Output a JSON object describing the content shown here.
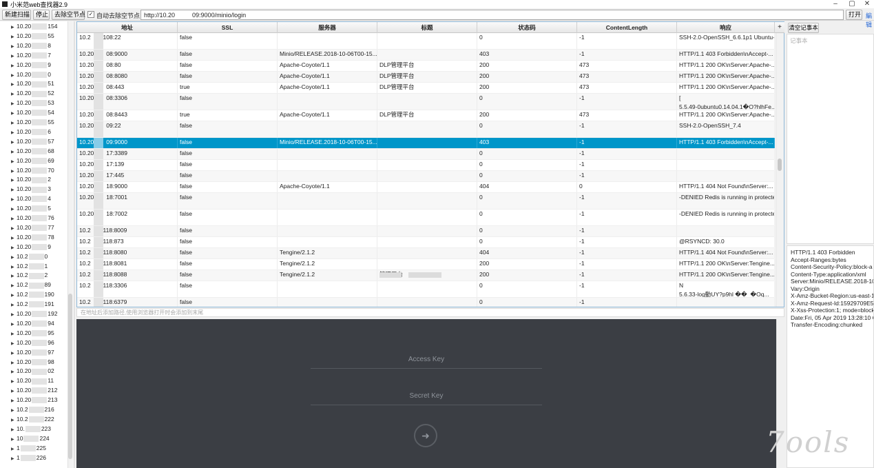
{
  "window": {
    "title": "小米范web查找器2.9",
    "min": "–",
    "max": "▢",
    "close": "✕"
  },
  "toolbar": {
    "new_scan": "新建扫描",
    "stop": "停止",
    "remove_empty": "去除空节点",
    "auto_remove_checked": "✓",
    "auto_remove_label": "自动去除空节点",
    "url_value": "http://10.20          09:9000/minio/login",
    "open": "打开",
    "edge_link": "編辑"
  },
  "tree": {
    "items": [
      {
        "pre": "10.20",
        "post": "154"
      },
      {
        "pre": "10.20",
        "post": "55"
      },
      {
        "pre": "10.20",
        "post": "8"
      },
      {
        "pre": "10.20",
        "post": "7"
      },
      {
        "pre": "10.20",
        "post": "9"
      },
      {
        "pre": "10.20",
        "post": "0"
      },
      {
        "pre": "10.20",
        "post": "51"
      },
      {
        "pre": "10.20",
        "post": "52"
      },
      {
        "pre": "10.20",
        "post": "53"
      },
      {
        "pre": "10.20",
        "post": "54"
      },
      {
        "pre": "10.20",
        "post": "55"
      },
      {
        "pre": "10.20",
        "post": "6"
      },
      {
        "pre": "10.20",
        "post": "57"
      },
      {
        "pre": "10.20",
        "post": "68"
      },
      {
        "pre": "10.20",
        "post": "69"
      },
      {
        "pre": "10.20",
        "post": "70"
      },
      {
        "pre": "10.20",
        "post": "2"
      },
      {
        "pre": "10.20",
        "post": "3"
      },
      {
        "pre": "10.20",
        "post": "4"
      },
      {
        "pre": "10.20",
        "post": "5"
      },
      {
        "pre": "10.20",
        "post": "76"
      },
      {
        "pre": "10.20",
        "post": "77"
      },
      {
        "pre": "10.20",
        "post": "78"
      },
      {
        "pre": "10.20",
        "post": "9"
      },
      {
        "pre": "10.2",
        "post": "0"
      },
      {
        "pre": "10.2",
        "post": "1"
      },
      {
        "pre": "10.2",
        "post": "2"
      },
      {
        "pre": "10.2",
        "post": "89"
      },
      {
        "pre": "10.2",
        "post": "190"
      },
      {
        "pre": "10.2",
        "post": "191"
      },
      {
        "pre": "10.20",
        "post": "192"
      },
      {
        "pre": "10.20",
        "post": "94"
      },
      {
        "pre": "10.20",
        "post": "95"
      },
      {
        "pre": "10.20",
        "post": "96"
      },
      {
        "pre": "10.20",
        "post": "97"
      },
      {
        "pre": "10.20",
        "post": "98"
      },
      {
        "pre": "10.20",
        "post": "02"
      },
      {
        "pre": "10.20",
        "post": "11"
      },
      {
        "pre": "10.20",
        "post": "212"
      },
      {
        "pre": "10.20",
        "post": "213"
      },
      {
        "pre": "10.2",
        "post": "216"
      },
      {
        "pre": "10.2",
        "post": "222"
      },
      {
        "pre": "10.",
        "post": "223"
      },
      {
        "pre": "10",
        "post": "224"
      },
      {
        "pre": "1",
        "post": "225"
      },
      {
        "pre": "1",
        "post": "226"
      }
    ]
  },
  "table": {
    "headers": [
      "地址",
      "SSL",
      "服务器",
      "标题",
      "状态码",
      "ContentLength",
      "响应"
    ],
    "more": "+",
    "rows": [
      {
        "addr_pre": "10.2",
        "addr": "108:22",
        "ssl": "false",
        "server": "",
        "title": "",
        "code": "0",
        "len": "-1",
        "resp": "SSH-2.0-OpenSSH_6.6.1p1 Ubuntu-2"
      },
      {
        "addr_pre": "10.20",
        "addr": "08:9000",
        "ssl": "false",
        "server": "Minio/RELEASE.2018-10-06T00-15...",
        "title": "",
        "code": "403",
        "len": "-1",
        "resp": "HTTP/1.1 403 Forbidden\\nAccept-..."
      },
      {
        "addr_pre": "10.20",
        "addr": "08:80",
        "ssl": "false",
        "server": "Apache-Coyote/1.1",
        "title": "DLP管理平台",
        "code": "200",
        "len": "473",
        "resp": "HTTP/1.1 200 OK\\nServer:Apache-..."
      },
      {
        "addr_pre": "10.20",
        "addr": "08:8080",
        "ssl": "false",
        "server": "Apache-Coyote/1.1",
        "title": "DLP管理平台",
        "code": "200",
        "len": "473",
        "resp": "HTTP/1.1 200 OK\\nServer:Apache-..."
      },
      {
        "addr_pre": "10.20",
        "addr": "08:443",
        "ssl": "true",
        "server": "Apache-Coyote/1.1",
        "title": "DLP管理平台",
        "code": "200",
        "len": "473",
        "resp": "HTTP/1.1 200 OK\\nServer:Apache-..."
      },
      {
        "addr_pre": "10.20",
        "addr": "08:3306",
        "ssl": "false",
        "server": "",
        "title": "",
        "code": "0",
        "len": "-1",
        "resp": "[\n5.5.49-0ubuntu0.14.04.1�O?hlhFe..."
      },
      {
        "addr_pre": "10.20",
        "addr": "08:8443",
        "ssl": "true",
        "server": "Apache-Coyote/1.1",
        "title": "DLP管理平台",
        "code": "200",
        "len": "473",
        "resp": "HTTP/1.1 200 OK\\nServer:Apache-..."
      },
      {
        "addr_pre": "10.20",
        "addr": "09:22",
        "ssl": "false",
        "server": "",
        "title": "",
        "code": "0",
        "len": "-1",
        "resp": "SSH-2.0-OpenSSH_7.4"
      },
      {
        "addr_pre": "10.20",
        "addr": "09:9000",
        "ssl": "false",
        "server": "Minio/RELEASE.2018-10-06T00-15...",
        "title": "",
        "code": "403",
        "len": "-1",
        "resp": "HTTP/1.1 403 Forbidden\\nAccept-..."
      },
      {
        "addr_pre": "10.20",
        "addr": "17:3389",
        "ssl": "false",
        "server": "",
        "title": "",
        "code": "0",
        "len": "-1",
        "resp": ""
      },
      {
        "addr_pre": "10.20",
        "addr": "17:139",
        "ssl": "false",
        "server": "",
        "title": "",
        "code": "0",
        "len": "-1",
        "resp": ""
      },
      {
        "addr_pre": "10.20",
        "addr": "17:445",
        "ssl": "false",
        "server": "",
        "title": "",
        "code": "0",
        "len": "-1",
        "resp": ""
      },
      {
        "addr_pre": "10.20",
        "addr": "18:9000",
        "ssl": "false",
        "server": "Apache-Coyote/1.1",
        "title": "",
        "code": "404",
        "len": "0",
        "resp": "HTTP/1.1 404 Not Found\\nServer:..."
      },
      {
        "addr_pre": "10.20",
        "addr": "18:7001",
        "ssl": "false",
        "server": "",
        "title": "",
        "code": "0",
        "len": "-1",
        "resp": "-DENIED Redis is running in protecte"
      },
      {
        "addr_pre": "10.20",
        "addr": "18:7002",
        "ssl": "false",
        "server": "",
        "title": "",
        "code": "0",
        "len": "-1",
        "resp": "-DENIED Redis is running in protecte"
      },
      {
        "addr_pre": "10.2",
        "addr": "118:8009",
        "ssl": "false",
        "server": "",
        "title": "",
        "code": "0",
        "len": "-1",
        "resp": ""
      },
      {
        "addr_pre": "10.2",
        "addr": "118:873",
        "ssl": "false",
        "server": "",
        "title": "",
        "code": "0",
        "len": "-1",
        "resp": "@RSYNCD: 30.0"
      },
      {
        "addr_pre": "10.2",
        "addr": "118:8080",
        "ssl": "false",
        "server": "Tengine/2.1.2",
        "title": "",
        "code": "404",
        "len": "-1",
        "resp": "HTTP/1.1 404 Not Found\\nServer:..."
      },
      {
        "addr_pre": "10.2",
        "addr": "118:8081",
        "ssl": "false",
        "server": "Tengine/2.1.2",
        "title": "",
        "code": "200",
        "len": "-1",
        "resp": "HTTP/1.1 200 OK\\nServer:Tengine..."
      },
      {
        "addr_pre": "10.2",
        "addr": "118:8088",
        "ssl": "false",
        "server": "Tengine/2.1.2",
        "title": "管理平台",
        "code": "200",
        "len": "-1",
        "resp": "HTTP/1.1 200 OK\\nServer:Tengine..."
      },
      {
        "addr_pre": "10.2",
        "addr": "118:3306",
        "ssl": "false",
        "server": "",
        "title": "",
        "code": "0",
        "len": "-1",
        "resp": "N\n5.6.33-log動UY?p9hl ��  �Oq..."
      },
      {
        "addr_pre": "10.2",
        "addr": "118:6379",
        "ssl": "false",
        "server": "",
        "title": "",
        "code": "0",
        "len": "-1",
        "resp": ""
      }
    ]
  },
  "hint": "在地址后添加路径,使用浏览器打开时会添加到末尾",
  "browser": {
    "access_key": "Access Key",
    "secret_key": "Secret Key",
    "login_icon": "➜"
  },
  "notes": {
    "clear_button": "清空记事本",
    "placeholder": "记事本"
  },
  "response": {
    "lines": [
      "HTTP/1.1 403 Forbidden",
      "Accept-Ranges:bytes",
      "Content-Security-Policy:block-a",
      "Content-Type:application/xml",
      "Server:Minio/RELEASE.2018-10-",
      "Vary:Origin",
      "X-Amz-Bucket-Region:us-east-1",
      "X-Amz-Request-Id:15929709E5A",
      "X-Xss-Protection:1; mode=block",
      "Date:Fri, 05 Apr 2019 13:28:10 G",
      "Transfer-Encoding:chunked"
    ]
  },
  "watermark": "7ools"
}
